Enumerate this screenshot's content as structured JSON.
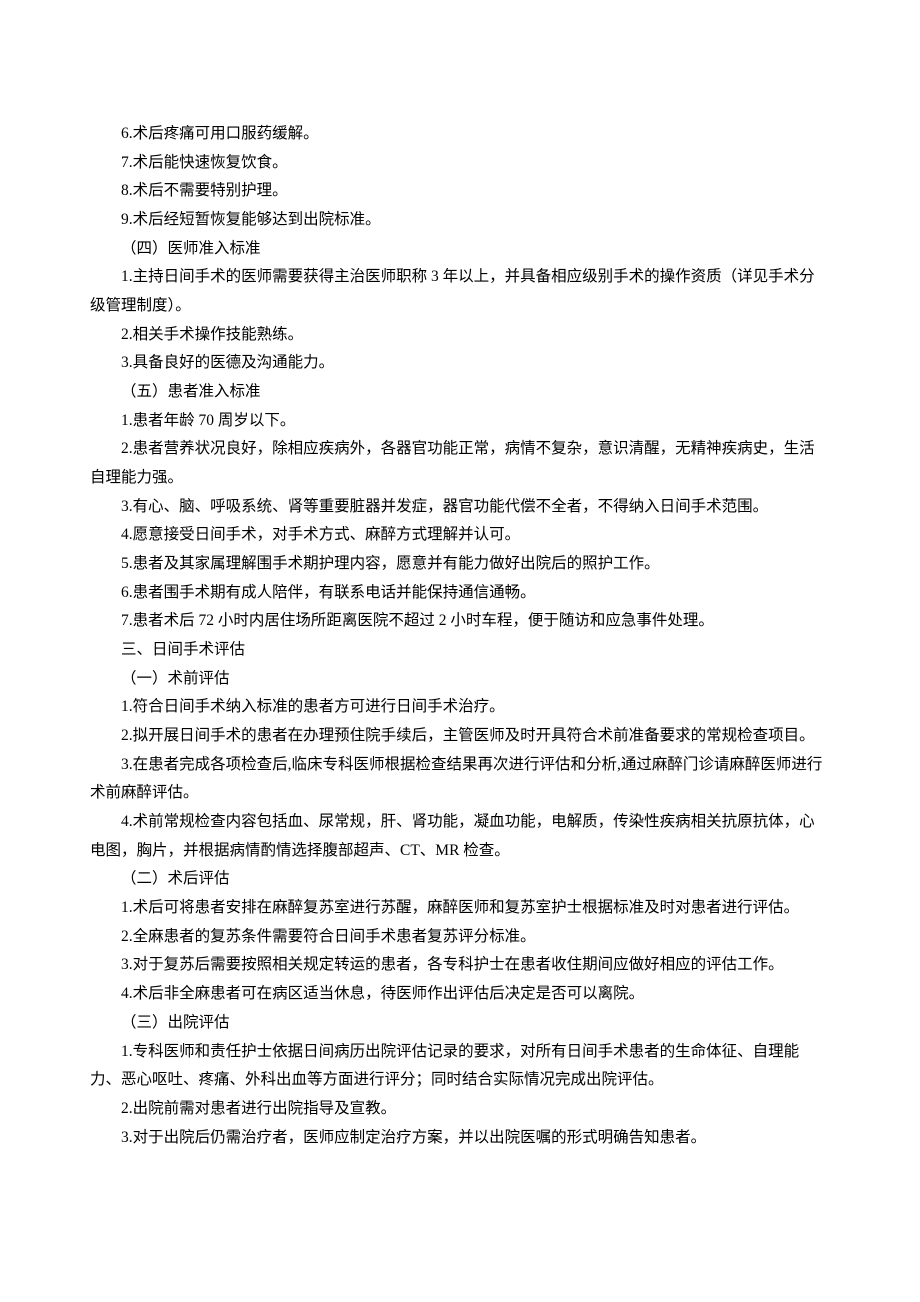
{
  "lines": [
    "6.术后疼痛可用口服药缓解。",
    "7.术后能快速恢复饮食。",
    "8.术后不需要特别护理。",
    "9.术后经短暂恢复能够达到出院标准。",
    "（四）医师准入标准",
    "1.主持日间手术的医师需要获得主治医师职称 3 年以上，并具备相应级别手术的操作资质（详见手术分级管理制度）。",
    "2.相关手术操作技能熟练。",
    "3.具备良好的医德及沟通能力。",
    "（五）患者准入标准",
    "1.患者年龄 70 周岁以下。",
    "2.患者营养状况良好，除相应疾病外，各器官功能正常，病情不复杂，意识清醒，无精神疾病史，生活自理能力强。",
    "3.有心、脑、呼吸系统、肾等重要脏器并发症，器官功能代偿不全者，不得纳入日间手术范围。",
    "4.愿意接受日间手术，对手术方式、麻醉方式理解并认可。",
    "5.患者及其家属理解围手术期护理内容，愿意并有能力做好出院后的照护工作。",
    "6.患者围手术期有成人陪伴，有联系电话并能保持通信通畅。",
    "7.患者术后 72 小时内居住场所距离医院不超过 2 小时车程，便于随访和应急事件处理。",
    "三、日间手术评估",
    "（一）术前评估",
    "1.符合日间手术纳入标准的患者方可进行日间手术治疗。",
    "2.拟开展日间手术的患者在办理预住院手续后，主管医师及时开具符合术前准备要求的常规检查项目。",
    "3.在患者完成各项检查后,临床专科医师根据检查结果再次进行评估和分析,通过麻醉门诊请麻醉医师进行术前麻醉评估。",
    "4.术前常规检查内容包括血、尿常规，肝、肾功能，凝血功能，电解质，传染性疾病相关抗原抗体，心电图，胸片，并根据病情酌情选择腹部超声、CT、MR 检查。",
    "（二）术后评估",
    "1.术后可将患者安排在麻醉复苏室进行苏醒，麻醉医师和复苏室护士根据标准及时对患者进行评估。",
    "2.全麻患者的复苏条件需要符合日间手术患者复苏评分标准。",
    "3.对于复苏后需要按照相关规定转运的患者，各专科护士在患者收住期间应做好相应的评估工作。",
    "4.术后非全麻患者可在病区适当休息，待医师作出评估后决定是否可以离院。",
    "（三）出院评估",
    "1.专科医师和责任护士依据日间病历出院评估记录的要求，对所有日间手术患者的生命体征、自理能力、恶心呕吐、疼痛、外科出血等方面进行评分；同时结合实际情况完成出院评估。",
    "2.出院前需对患者进行出院指导及宣教。",
    "3.对于出院后仍需治疗者，医师应制定治疗方案，并以出院医嘱的形式明确告知患者。"
  ]
}
